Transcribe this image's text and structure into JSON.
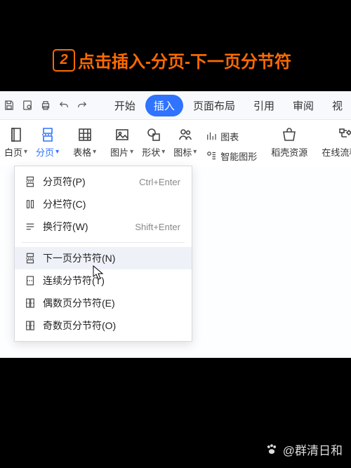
{
  "instruction": {
    "step_number": "2",
    "text": "点击插入-分页-下一页分节符"
  },
  "tabs": {
    "start": "开始",
    "insert": "插入",
    "layout": "页面布局",
    "reference": "引用",
    "review": "审阅",
    "view_partial": "视"
  },
  "ribbon": {
    "page_partial": "白页",
    "page_break": "分页",
    "table": "表格",
    "picture": "图片",
    "shape": "形状",
    "icon": "图标",
    "chart": "图表",
    "smart_art": "智能图形",
    "resource": "稻壳资源",
    "flowchart": "在线流程图",
    "extra_partial": "在"
  },
  "dropdown": {
    "items": [
      {
        "label": "分页符(P)",
        "shortcut": "Ctrl+Enter"
      },
      {
        "label": "分栏符(C)",
        "shortcut": ""
      },
      {
        "label": "换行符(W)",
        "shortcut": "Shift+Enter"
      },
      {
        "label": "下一页分节符(N)",
        "shortcut": ""
      },
      {
        "label": "连续分节符(T)",
        "shortcut": ""
      },
      {
        "label": "偶数页分节符(E)",
        "shortcut": ""
      },
      {
        "label": "奇数页分节符(O)",
        "shortcut": ""
      }
    ]
  },
  "watermark": {
    "author": "@群清日和"
  }
}
